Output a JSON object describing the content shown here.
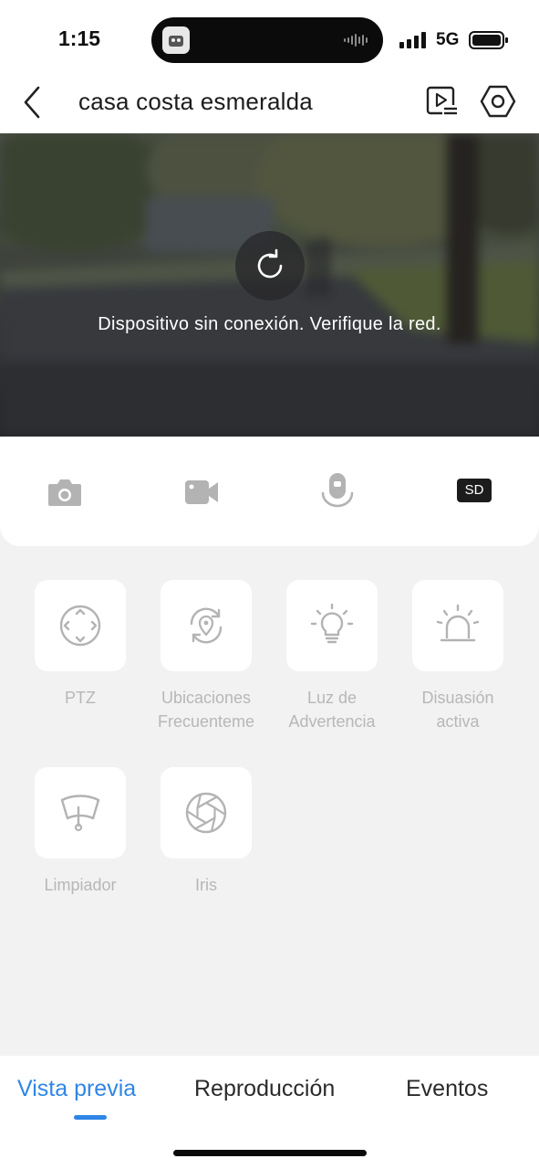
{
  "status_bar": {
    "time": "1:15",
    "network": "5G",
    "signal_icon": "signal-bars-icon",
    "battery_icon": "battery-icon"
  },
  "header": {
    "title": "casa costa esmeralda",
    "back_icon": "chevron-left-icon",
    "playback_icon": "playback-list-icon",
    "settings_icon": "hexagon-settings-icon"
  },
  "live_view": {
    "status_message": "Dispositivo sin conexión. Verifique la red.",
    "reload_icon": "refresh-icon"
  },
  "toolbar": {
    "items": [
      {
        "icon": "camera-icon"
      },
      {
        "icon": "video-camera-icon"
      },
      {
        "icon": "microphone-icon"
      }
    ],
    "quality_label": "SD"
  },
  "features": [
    {
      "label_lines": [
        "PTZ"
      ],
      "icon": "ptz-icon"
    },
    {
      "label_lines": [
        "Ubicaciones",
        "Frecuenteme"
      ],
      "icon": "location-cycle-icon"
    },
    {
      "label_lines": [
        "Luz de",
        "Advertencia"
      ],
      "icon": "light-bulb-icon"
    },
    {
      "label_lines": [
        "Disuasión",
        "activa"
      ],
      "icon": "siren-icon"
    },
    {
      "label_lines": [
        "Limpiador"
      ],
      "icon": "wiper-icon"
    },
    {
      "label_lines": [
        "Iris"
      ],
      "icon": "aperture-icon"
    }
  ],
  "tabs": [
    {
      "label": "Vista previa",
      "active": true
    },
    {
      "label": "Reproducción",
      "active": false
    },
    {
      "label": "Eventos",
      "active": false
    }
  ],
  "colors": {
    "accent": "#2f86e6",
    "feature_label": "#b7b7b7",
    "icon_gray": "#b3b3b3",
    "background": "#f2f2f2"
  }
}
